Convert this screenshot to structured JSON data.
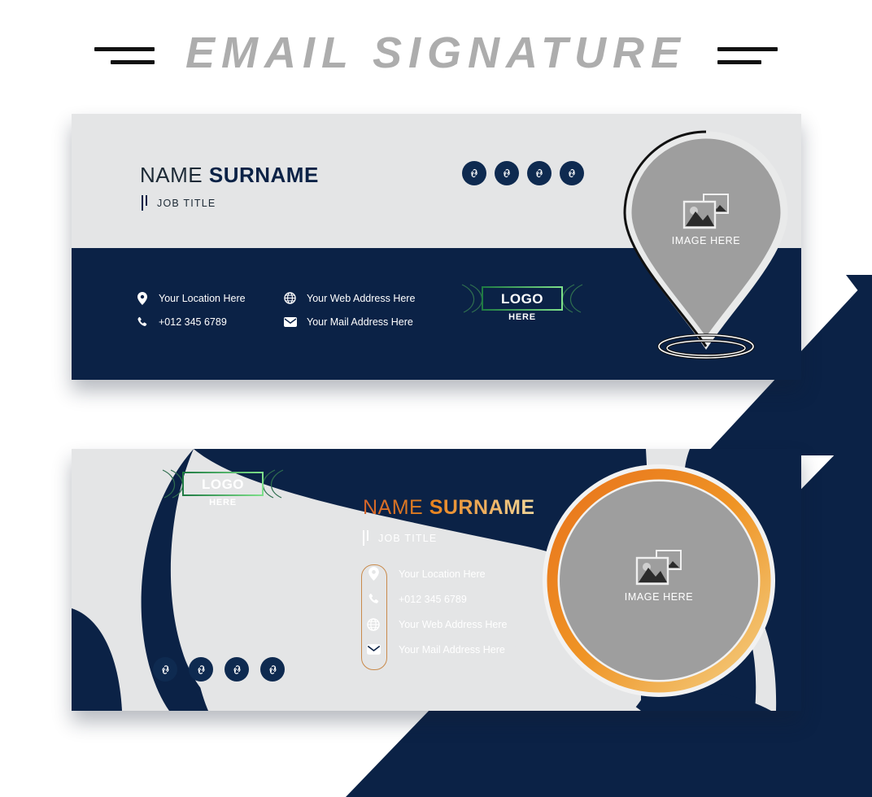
{
  "page": {
    "heading": "EMAIL SIGNATURE",
    "background_color": "#ffffff",
    "band_color": "#0b2246"
  },
  "colors": {
    "navy": "#0b2246",
    "navy_dark": "#0a1f3f",
    "light_gray": "#e4e5e6",
    "placeholder_gray": "#9e9e9e",
    "heading_gray": "#adadad",
    "orange": "#e8811c",
    "gold": "#f2d79a",
    "capsule_border": "#c98a4b",
    "logo_green_dark": "#1f7a43",
    "logo_green_light": "#7ee08a"
  },
  "card1": {
    "name_first": "NAME",
    "name_last": "SURNAME",
    "job_title": "JOB TITLE",
    "logo": {
      "main": "LOGO",
      "sub": "HERE"
    },
    "image_placeholder": {
      "label": "IMAGE HERE",
      "icon": "image-placeholder-icon",
      "shape": "map-pin"
    },
    "social": [
      {
        "icon": "link-icon",
        "name": "social-link-1"
      },
      {
        "icon": "link-icon",
        "name": "social-link-2"
      },
      {
        "icon": "link-icon",
        "name": "social-link-3"
      },
      {
        "icon": "link-icon",
        "name": "social-link-4"
      }
    ],
    "contacts": [
      {
        "icon": "location-pin-icon",
        "text": "Your Location Here"
      },
      {
        "icon": "globe-icon",
        "text": "Your Web Address Here"
      },
      {
        "icon": "phone-icon",
        "text": "+012 345 6789"
      },
      {
        "icon": "envelope-icon",
        "text": "Your Mail Address Here"
      }
    ]
  },
  "card2": {
    "name_first": "NAME",
    "name_last": "SURNAME",
    "job_title": "JOB TITLE",
    "logo": {
      "main": "LOGO",
      "sub": "HERE"
    },
    "image_placeholder": {
      "label": "IMAGE HERE",
      "icon": "image-placeholder-icon",
      "shape": "circle"
    },
    "social": [
      {
        "icon": "link-icon",
        "name": "social-link-1"
      },
      {
        "icon": "link-icon",
        "name": "social-link-2"
      },
      {
        "icon": "link-icon",
        "name": "social-link-3"
      },
      {
        "icon": "link-icon",
        "name": "social-link-4"
      }
    ],
    "contacts": [
      {
        "icon": "location-pin-icon",
        "text": "Your Location Here"
      },
      {
        "icon": "phone-icon",
        "text": "+012 345 6789"
      },
      {
        "icon": "globe-icon",
        "text": "Your Web Address Here"
      },
      {
        "icon": "envelope-icon",
        "text": "Your Mail Address Here"
      }
    ]
  }
}
